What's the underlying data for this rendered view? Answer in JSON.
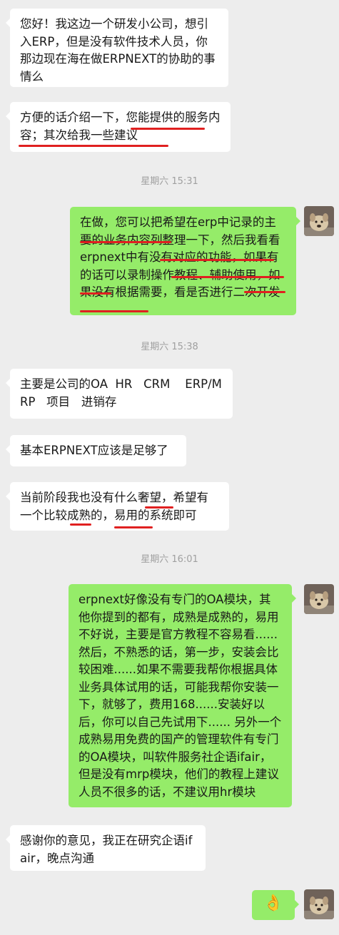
{
  "chat": {
    "messages": [
      {
        "text": "您好！我这边一个研发小公司，想引入ERP，但是没有软件技术人员，你那边现在海在做ERPNEXT的协助的事情么"
      },
      {
        "text": "方便的话介绍一下，您能提供的服务内容；其次给我一些建议"
      },
      {
        "text": "在做，您可以把希望在erp中记录的主要的业务内容列整理一下，然后我看看erpnext中有没有对应的功能，如果有的话可以录制操作教程、辅助使用，如果没有根据需要，看是否进行二次开发"
      },
      {
        "text": "主要是公司的OA  HR   CRM    ERP/MRP   项目   进销存"
      },
      {
        "text": "基本ERPNEXT应该是足够了"
      },
      {
        "text": "当前阶段我也没有什么奢望，希望有一个比较成熟的，易用的系统即可"
      },
      {
        "text": "erpnext好像没有专门的OA模块，其他你提到的都有，成熟是成熟的，易用不好说，主要是官方教程不容易看......然后，不熟悉的话，第一步，安装会比较困难......如果不需要我帮你根据具体业务具体试用的话，可能我帮你安装一下，就够了，费用168......安装好以后，你可以自己先试用下...... 另外一个成熟易用免费的国产的管理软件有专门的OA模块，叫软件服务社企语ifair，但是没有mrp模块，他们的教程上建议人员不很多的话，不建议用hr模块"
      },
      {
        "text": "感谢你的意见，我正在研究企语ifair，晚点沟通"
      },
      {
        "text": "👌"
      }
    ],
    "timestamps": [
      "星期六 15:31",
      "星期六 15:38",
      "星期六 16:01"
    ]
  },
  "colors": {
    "background": "#ededed",
    "incoming": "#ffffff",
    "outgoing": "#95ec69",
    "timestamp": "#a0a0a0",
    "underline": "#e02020"
  },
  "icons": {
    "avatar": "dog-photo-avatar"
  }
}
